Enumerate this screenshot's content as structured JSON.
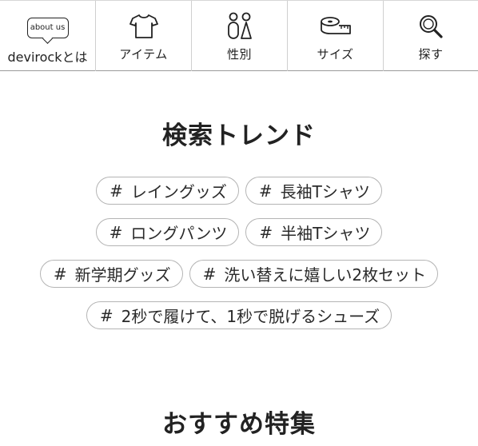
{
  "nav": {
    "items": [
      {
        "label": "devirockとは",
        "icon": "about-us-bubble-icon",
        "icon_text": "about us"
      },
      {
        "label": "アイテム",
        "icon": "tshirt-icon"
      },
      {
        "label": "性別",
        "icon": "gender-icon"
      },
      {
        "label": "サイズ",
        "icon": "measuring-tape-icon"
      },
      {
        "label": "探す",
        "icon": "search-icon"
      }
    ]
  },
  "trend": {
    "title": "検索トレンド",
    "hash_symbol": "#",
    "tags": [
      "レイングッズ",
      "長袖Tシャツ",
      "ロングパンツ",
      "半袖Tシャツ",
      "新学期グッズ",
      "洗い替えに嬉しい2枚セット",
      "2秒で履けて、1秒で脱げるシューズ"
    ]
  },
  "recommend": {
    "title": "おすすめ特集"
  },
  "colors": {
    "text": "#222222",
    "tag_border": "#b4b4b4",
    "divider": "#cfcfcf"
  }
}
